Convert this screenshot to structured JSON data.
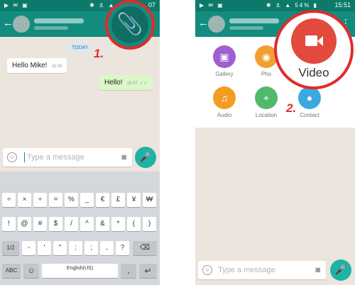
{
  "left_phone": {
    "status": {
      "left_icons": "▶ ✉ ▣",
      "right_icons": "✱ ⚓ ▲ ▮",
      "time": "07"
    },
    "day_label": "TODAY",
    "messages": [
      {
        "text": "Hello Mike!",
        "time": "15:06",
        "direction": "incoming"
      },
      {
        "text": "Hello!",
        "time": "15:07",
        "direction": "outgoing",
        "status": "✓✓"
      }
    ],
    "input": {
      "placeholder": "Type a message"
    },
    "step_label": "1.",
    "keyboard": {
      "row1": [
        "÷",
        "×",
        "÷",
        "=",
        "%",
        "_",
        "€",
        "£",
        "¥",
        "₩"
      ],
      "row2": [
        "!",
        "@",
        "#",
        "$",
        "/",
        "^",
        "&",
        "*",
        "(",
        ")"
      ],
      "row3": [
        "1/2",
        "-",
        "'",
        "\"",
        ":",
        ";",
        ",",
        "?",
        "⌫"
      ],
      "row4": {
        "abc": "ABC",
        "space": "English(US)",
        "enter": "↵"
      }
    }
  },
  "right_phone": {
    "status": {
      "left_icons": "▶ ✉ ▣",
      "right_icons": "✱ ⚓ ▲ 54% ▮",
      "time": "15:51"
    },
    "attachments": [
      {
        "label": "Gallery",
        "color": "#a05fd0",
        "icon": "gallery-icon"
      },
      {
        "label": "Pho",
        "color": "#f0a030",
        "icon": "photo-icon"
      },
      {
        "label": "Audio",
        "color": "#f39c24",
        "icon": "headphones-icon"
      },
      {
        "label": "Location",
        "color": "#53b96a",
        "icon": "map-icon"
      },
      {
        "label": "Contact",
        "color": "#3ba8e0",
        "icon": "contact-icon"
      }
    ],
    "video": {
      "label": "Video",
      "color": "#e24a3d"
    },
    "input": {
      "placeholder": "Type a message"
    },
    "step_label": "2."
  },
  "colors": {
    "whatsapp_dark": "#0b7a6b",
    "whatsapp_green": "#128c7e",
    "highlight_red": "#e22b2b"
  }
}
